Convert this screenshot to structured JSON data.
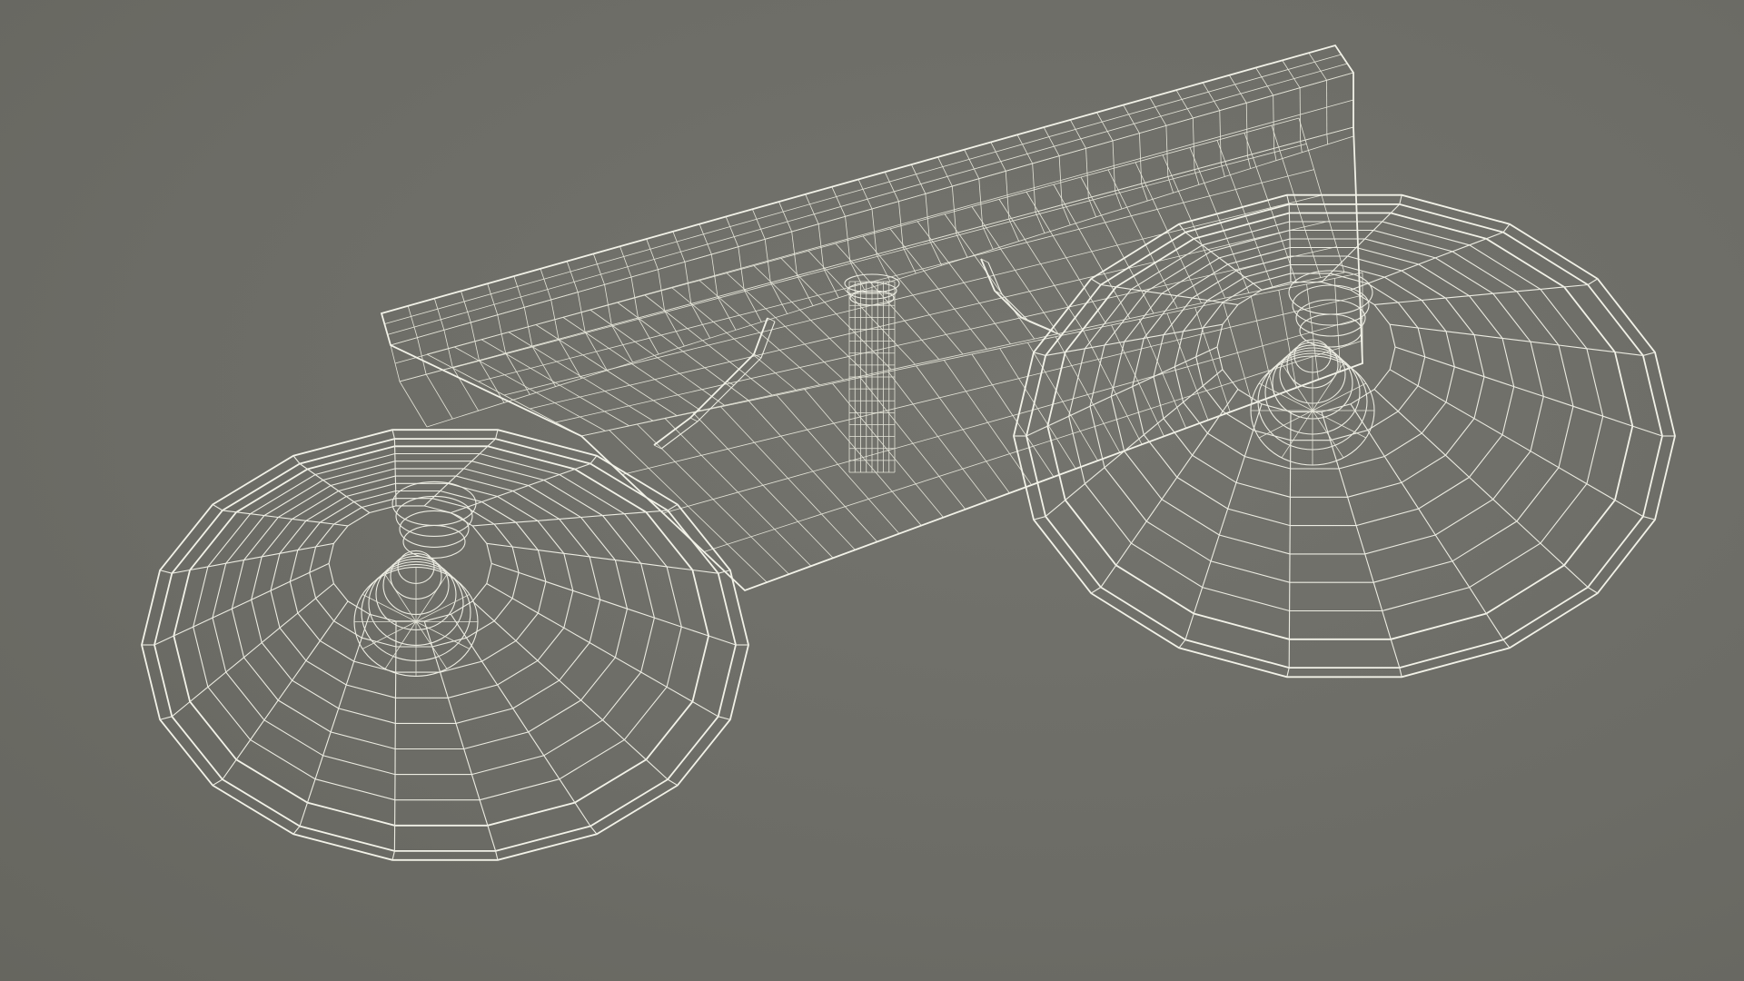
{
  "scene": {
    "subject": "wireframe-vanity-light",
    "background_color": "#6e6e68",
    "wire_color": "#ecece2",
    "shade_count": 2,
    "has_backplate": true,
    "has_center_stem": true
  }
}
